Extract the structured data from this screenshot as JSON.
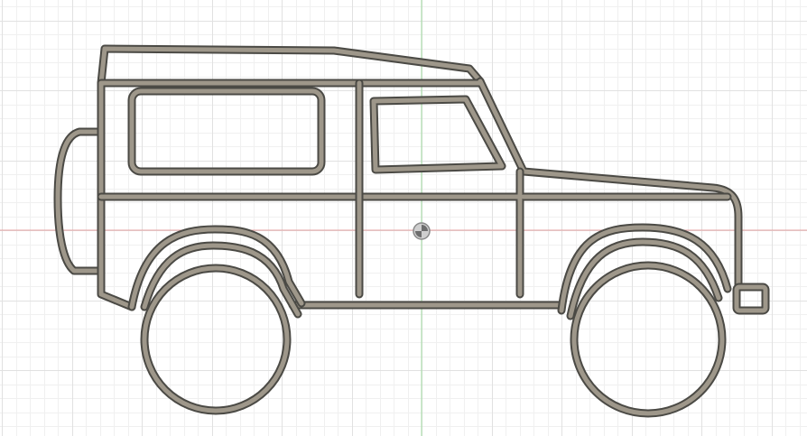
{
  "viewport": {
    "background_color": "#ffffff",
    "grid_minor_color": "#f0f0f0",
    "grid_major_color": "#e1e1e1",
    "axis_x_color": "#e6a0a0",
    "axis_y_color": "#a0dba0"
  },
  "sketch": {
    "subject": "vehicle-side-profile",
    "outline_color": "#4b4a45",
    "fill_color": "#9e978a",
    "origin_icon": "origin-marker-icon"
  }
}
